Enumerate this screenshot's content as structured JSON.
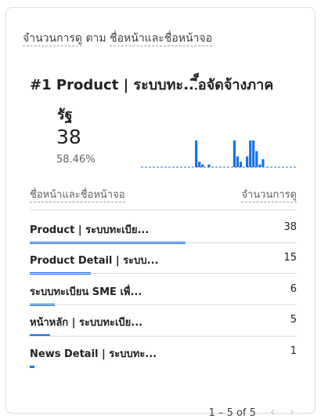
{
  "header": {
    "metric": "จำนวนการดู",
    "by": "ตาม",
    "dimension": "ชื่อหน้าและชื่อหน้าจอ"
  },
  "top": {
    "rank": "#1",
    "title_line1": "Product | ระบบทะ...ี็อจัดจ้างภาค",
    "title_line2": "รัฐ",
    "count": "38",
    "percent": "58.46%",
    "sparkline": [
      0,
      0,
      0,
      0,
      0,
      0,
      0,
      0,
      0,
      0,
      0,
      0,
      0,
      0,
      0,
      0,
      0,
      1,
      0.2,
      0.1,
      0,
      0.1,
      0,
      0,
      0,
      0,
      0,
      0,
      0,
      1,
      0.4,
      0.2,
      0,
      0.4,
      1,
      1,
      0.6,
      0.1,
      0.3,
      0,
      0,
      0,
      0,
      0,
      0,
      0,
      0,
      0,
      0
    ]
  },
  "table": {
    "col_dimension": "ชื่อหน้าและชื่อหน้าจอ",
    "col_metric": "จำนวนการดู",
    "rows": [
      {
        "label": "Product | ระบบทะเบีย...",
        "value": "38",
        "share": 1.0
      },
      {
        "label": "Product Detail | ระบบ...",
        "value": "15",
        "share": 0.39
      },
      {
        "label": "ระบบทะเบียน SME เพื่...",
        "value": "6",
        "share": 0.16
      },
      {
        "label": "หน้าหลัก | ระบบทะเบีย...",
        "value": "5",
        "share": 0.13
      },
      {
        "label": "News Detail | ระบบทะ...",
        "value": "1",
        "share": 0.03
      }
    ]
  },
  "pagination": {
    "text": "1 – 5 of 5",
    "prev_icon": "chevron-left-icon",
    "next_icon": "chevron-right-icon"
  },
  "colors": {
    "accent": "#1a73e8",
    "text": "#202124",
    "muted": "#5f6368"
  }
}
